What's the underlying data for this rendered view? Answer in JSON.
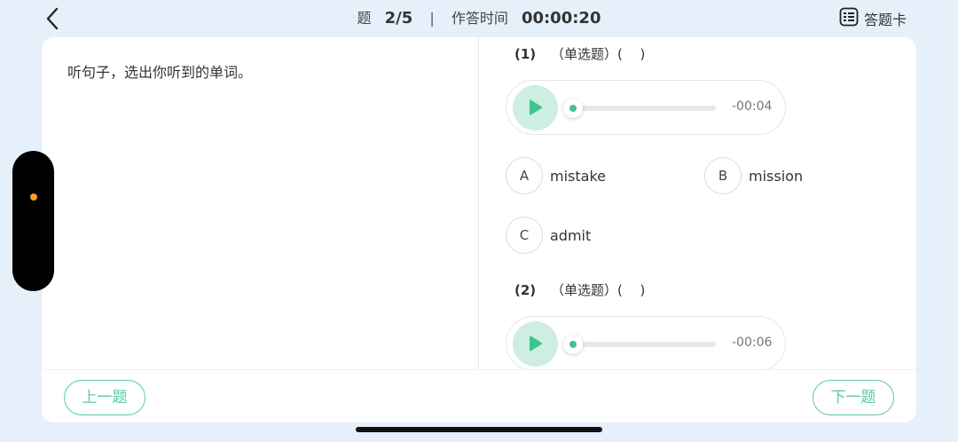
{
  "header": {
    "question_label": "题",
    "progress": "2/5",
    "separator": "|",
    "time_label": "作答时间",
    "time": "00:00:20",
    "answer_card_label": "答题卡"
  },
  "prompt": "听句子，选出你听到的单词。",
  "questions": [
    {
      "number": "(1)",
      "type": "（单选题）(　 )",
      "duration": "-00:04",
      "options": [
        {
          "letter": "A",
          "text": "mistake"
        },
        {
          "letter": "B",
          "text": "mission"
        },
        {
          "letter": "C",
          "text": "admit"
        }
      ]
    },
    {
      "number": "(2)",
      "type": "（单选题）(　 )",
      "duration": "-00:06"
    }
  ],
  "footer": {
    "prev_label": "上一题",
    "next_label": "下一题"
  },
  "colors": {
    "accent": "#5cc9a0",
    "play_bg": "#cdeee0",
    "page_bg": "#e6f0fb",
    "handle_dot": "#f0a020"
  },
  "icons": [
    "back-chevron-icon",
    "answer-card-grid-icon",
    "play-icon"
  ]
}
